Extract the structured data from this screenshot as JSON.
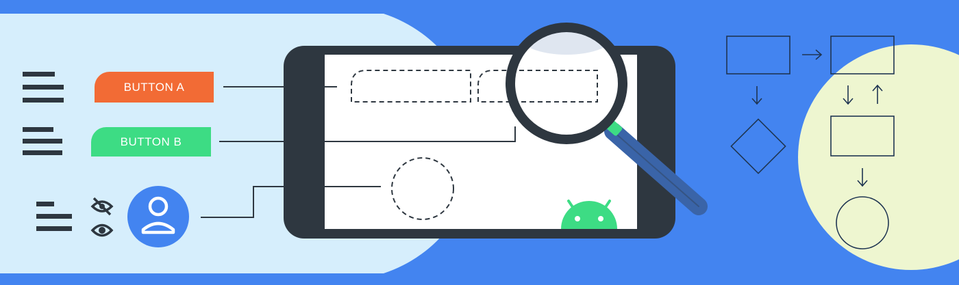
{
  "buttons": {
    "a": {
      "label": "BUTTON A"
    },
    "b": {
      "label": "BUTTON B"
    }
  },
  "colors": {
    "background": "#4384f0",
    "left_panel": "#d6eefc",
    "right_panel": "#eef6d0",
    "phone_body": "#2e3740",
    "screen": "#ffffff",
    "button_a": "#f26b35",
    "button_b": "#3ddc84",
    "avatar": "#4384f0",
    "android_green": "#3ddc84",
    "magnifier_handle": "#3a64a8",
    "outline": "#1f3552"
  },
  "icons": [
    "text-lines-icon",
    "visibility-off-icon",
    "visibility-icon",
    "account-avatar-icon",
    "magnifying-glass-icon",
    "android-robot-icon",
    "flowchart-icon"
  ]
}
